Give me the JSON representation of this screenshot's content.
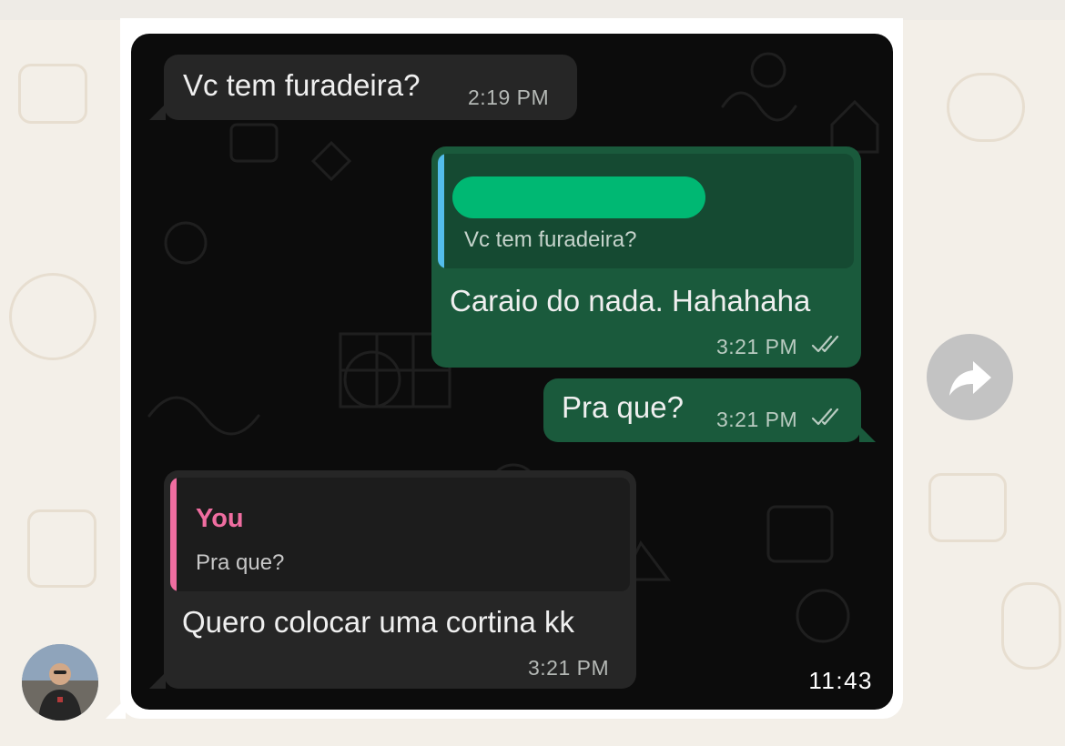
{
  "messages": [
    {
      "direction": "incoming",
      "text": "Vc tem furadeira?",
      "time": "2:19 PM"
    },
    {
      "direction": "outgoing",
      "quote_text": "Vc tem furadeira?",
      "text": "Caraio do nada. Hahahaha",
      "time": "3:21 PM",
      "status": "read"
    },
    {
      "direction": "outgoing",
      "text": "Pra que?",
      "time": "3:21 PM",
      "status": "read"
    },
    {
      "direction": "incoming",
      "quote_author": "You",
      "quote_text": "Pra que?",
      "text": "Quero colocar uma cortina kk",
      "time": "3:21 PM"
    }
  ],
  "video_timestamp": "11:43",
  "colors": {
    "chat_bg": "#0c0c0c",
    "incoming_bubble": "#262626",
    "outgoing_bubble": "#1a5a3c",
    "quote_bar_outgoing": "#53bdeb",
    "quote_bar_incoming": "#ef6da0",
    "quote_author_color": "#ef6da0",
    "redaction_green": "#00b873",
    "read_tick": "#b9cbc1"
  },
  "icons": {
    "share": "share-forward-icon",
    "ticks": "double-check-icon",
    "avatar": "contact-avatar"
  }
}
